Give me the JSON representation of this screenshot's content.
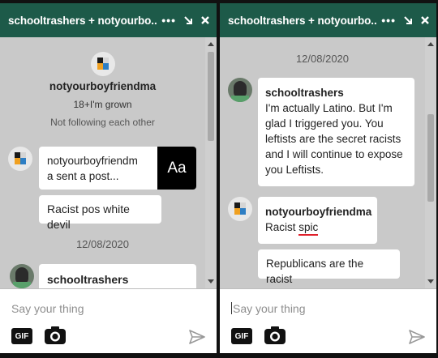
{
  "left": {
    "title": "schooltrashers + notyourbo...",
    "profile": {
      "name": "notyourboyfriendma",
      "subtitle": "18+I'm grown",
      "follow_status": "Not following each other"
    },
    "post_preview": {
      "text_line1": "notyourboyfriendm",
      "text_line2": "a sent a post...",
      "thumb_label": "Aa"
    },
    "message1": "Racist pos white devil",
    "date": "12/08/2020",
    "partial_sender": "schooltrashers",
    "input_placeholder": "Say your thing"
  },
  "right": {
    "title": "schooltrashers + notyourbo...",
    "date": "12/08/2020",
    "msg1": {
      "sender": "schooltrashers",
      "lines": [
        "I'm actually Latino. But I'm",
        "glad I triggered you. You",
        "leftists are the secret racists",
        "and I will continue to expose",
        "you Leftists."
      ]
    },
    "msg2": {
      "sender": "notyourboyfriendma",
      "text_prefix": "Racist ",
      "text_underlined": "spic"
    },
    "msg3": "Republicans are the racist",
    "input_placeholder": "Say your thing"
  },
  "composer": {
    "gif_label": "GIF"
  },
  "colors": {
    "titlebar": "#1d5a49",
    "panel_bg": "#c9c9c9",
    "spellcheck_underline": "#e0202a"
  },
  "icons": [
    "more-icon",
    "minimize-icon",
    "close-icon",
    "camera-icon",
    "send-icon",
    "gif-icon"
  ]
}
